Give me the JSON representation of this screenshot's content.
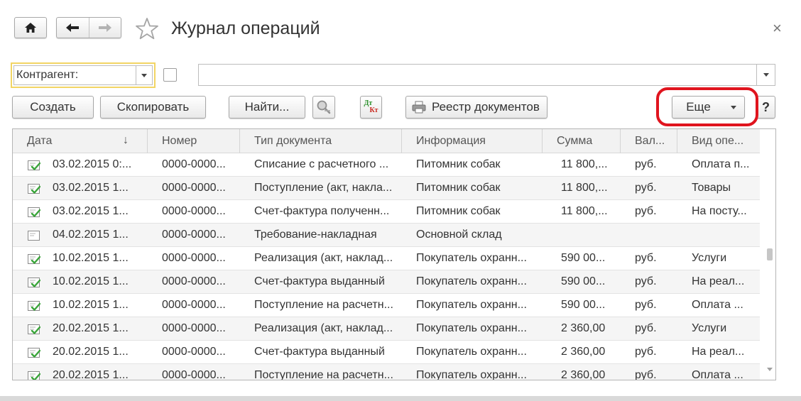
{
  "window": {
    "title": "Журнал операций",
    "close_glyph": "×"
  },
  "nav": {
    "home_icon": "home-icon",
    "back_icon": "arrow-left-icon",
    "forward_icon": "arrow-right-icon",
    "favorite_icon": "star-icon"
  },
  "filter": {
    "field_label": "Контрагент:",
    "checked": false,
    "value": ""
  },
  "toolbar": {
    "create_label": "Создать",
    "copy_label": "Скопировать",
    "find_label": "Найти...",
    "dtkt_top": "Дт",
    "dtkt_bottom": "Кт",
    "registry_label": "Реестр документов",
    "more_label": "Еще",
    "help_label": "?"
  },
  "table": {
    "columns": [
      "Дата",
      "Номер",
      "Тип документа",
      "Информация",
      "Сумма",
      "Вал...",
      "Вид опе..."
    ],
    "sort_indicator": "↓",
    "rows": [
      {
        "posted": true,
        "date": "03.02.2015 0:...",
        "number": "0000-0000...",
        "doc_type": "Списание с расчетного ...",
        "info": "Питомник собак",
        "sum": "11 800,...",
        "currency": "руб.",
        "op_type": "Оплата п..."
      },
      {
        "posted": true,
        "date": "03.02.2015 1...",
        "number": "0000-0000...",
        "doc_type": "Поступление (акт, накла...",
        "info": "Питомник собак",
        "sum": "11 800,...",
        "currency": "руб.",
        "op_type": "Товары"
      },
      {
        "posted": true,
        "date": "03.02.2015 1...",
        "number": "0000-0000...",
        "doc_type": "Счет-фактура полученн...",
        "info": "Питомник собак",
        "sum": "11 800,...",
        "currency": "руб.",
        "op_type": "На посту..."
      },
      {
        "posted": false,
        "date": "04.02.2015 1...",
        "number": "0000-0000...",
        "doc_type": "Требование-накладная",
        "info": "Основной склад",
        "sum": "",
        "currency": "",
        "op_type": ""
      },
      {
        "posted": true,
        "date": "10.02.2015 1...",
        "number": "0000-0000...",
        "doc_type": "Реализация (акт, наклад...",
        "info": "Покупатель охранн...",
        "sum": "590 00...",
        "currency": "руб.",
        "op_type": "Услуги"
      },
      {
        "posted": true,
        "date": "10.02.2015 1...",
        "number": "0000-0000...",
        "doc_type": "Счет-фактура выданный",
        "info": "Покупатель охранн...",
        "sum": "590 00...",
        "currency": "руб.",
        "op_type": "На реал..."
      },
      {
        "posted": true,
        "date": "10.02.2015 1...",
        "number": "0000-0000...",
        "doc_type": "Поступление на расчетн...",
        "info": "Покупатель охранн...",
        "sum": "590 00...",
        "currency": "руб.",
        "op_type": "Оплата ..."
      },
      {
        "posted": true,
        "date": "20.02.2015 1...",
        "number": "0000-0000...",
        "doc_type": "Реализация (акт, наклад...",
        "info": "Покупатель охранн...",
        "sum": "2 360,00",
        "currency": "руб.",
        "op_type": "Услуги"
      },
      {
        "posted": true,
        "date": "20.02.2015 1...",
        "number": "0000-0000...",
        "doc_type": "Счет-фактура выданный",
        "info": "Покупатель охранн...",
        "sum": "2 360,00",
        "currency": "руб.",
        "op_type": "На реал..."
      },
      {
        "posted": true,
        "date": "20.02.2015 1...",
        "number": "0000-0000...",
        "doc_type": "Поступление на расчетн...",
        "info": "Покупатель охранн...",
        "sum": "2 360,00",
        "currency": "руб.",
        "op_type": "Оплата ..."
      }
    ]
  },
  "colors": {
    "highlight_oval": "#e0141e",
    "focused_field_border": "#f2d564",
    "posted_check": "#3aa43a"
  }
}
